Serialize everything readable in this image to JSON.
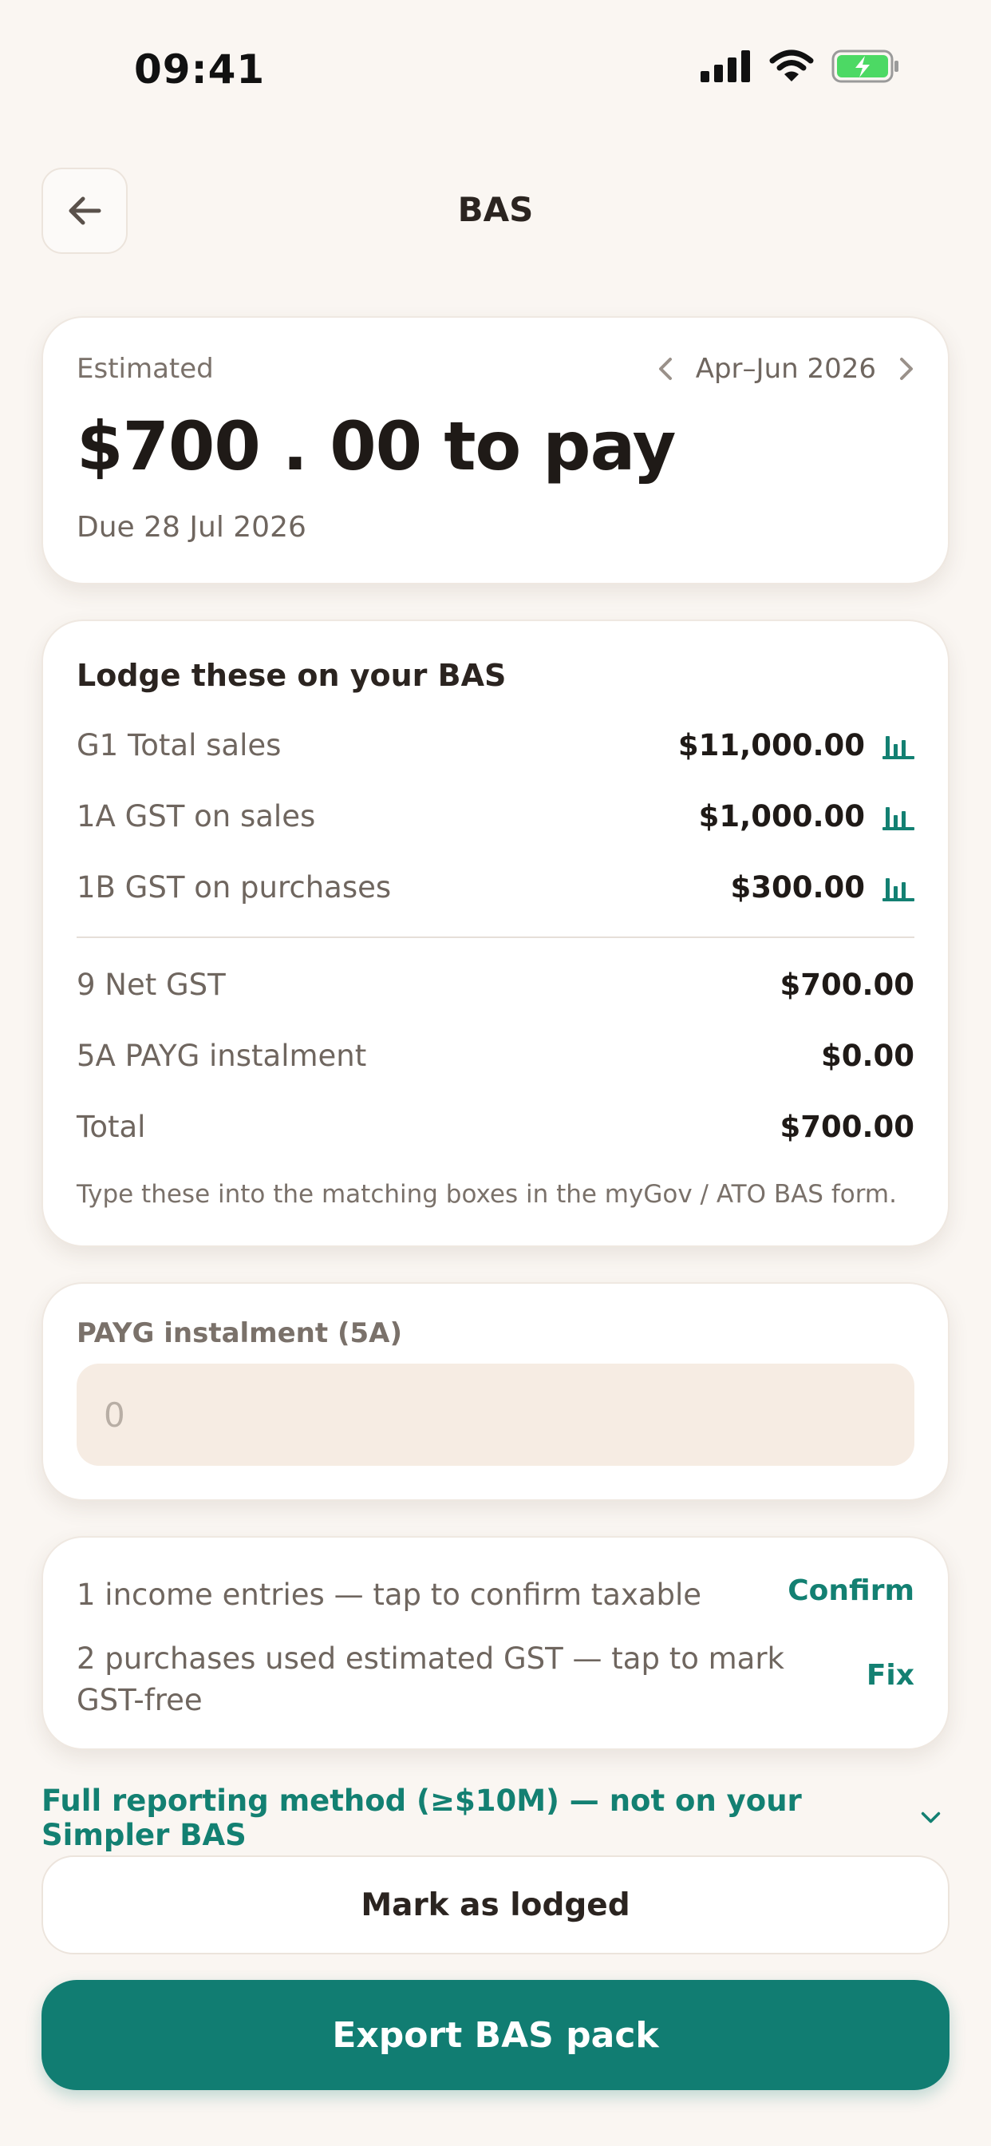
{
  "status_bar": {
    "time": "09:41"
  },
  "header": {
    "title": "BAS"
  },
  "estimate": {
    "label": "Estimated",
    "period": "Apr–Jun 2026",
    "amount": "$700 . 00 to pay",
    "due": "Due 28 Jul 2026"
  },
  "lodge": {
    "title": "Lodge these on your BAS",
    "rows": [
      {
        "label": "G1 Total sales",
        "value": "$11,000.00"
      },
      {
        "label": "1A GST on sales",
        "value": "$1,000.00"
      },
      {
        "label": "1B GST on purchases",
        "value": "$300.00"
      },
      {
        "label": "9 Net GST",
        "value": "$700.00"
      },
      {
        "label": "5A PAYG instalment",
        "value": "$0.00"
      },
      {
        "label": "Total",
        "value": "$700.00"
      }
    ],
    "hint": "Type these into the matching boxes in the myGov / ATO BAS form."
  },
  "payg": {
    "label": "PAYG instalment (5A)",
    "placeholder": "0"
  },
  "issues": [
    {
      "text": "1 income entries — tap to confirm taxable",
      "action": "Confirm"
    },
    {
      "text": "2 purchases used estimated GST — tap to mark GST-free",
      "action": "Fix"
    }
  ],
  "full_reporting": {
    "label": "Full reporting method (≥$10M) — not on your Simpler BAS"
  },
  "buttons": {
    "mark_lodged": "Mark as lodged",
    "export": "Export BAS pack"
  },
  "colors": {
    "accent": "#117d72",
    "background": "#faf6f2",
    "battery": "#4cd964"
  },
  "icons": [
    "back-arrow-icon",
    "chevron-left-icon",
    "chevron-right-icon",
    "bar-chart-icon",
    "chevron-down-icon",
    "signal-icon",
    "wifi-icon",
    "battery-icon"
  ]
}
